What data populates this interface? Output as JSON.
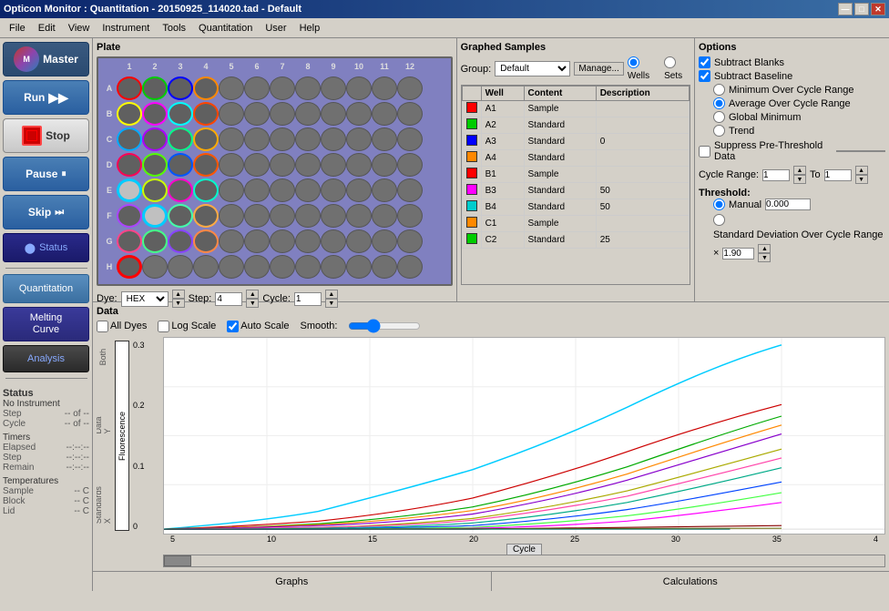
{
  "title": "Opticon Monitor : Quantitation - 20150925_114020.tad - Default",
  "titlebar": {
    "buttons": [
      "—",
      "□",
      "✕"
    ]
  },
  "menu": {
    "items": [
      "File",
      "Edit",
      "View",
      "Instrument",
      "Tools",
      "Quantitation",
      "User",
      "Help"
    ]
  },
  "sidebar": {
    "master_label": "Master",
    "run_label": "Run",
    "stop_label": "Stop",
    "pause_label": "Pause",
    "skip_label": "Skip",
    "status_label": "Status",
    "quantitation_label": "Quantitation",
    "melting_curve_label": "Melting\nCurve",
    "analysis_label": "Analysis"
  },
  "status": {
    "title": "Status",
    "instrument": "No Instrument",
    "step_label": "Step",
    "step_value": "-- of --",
    "cycle_label": "Cycle",
    "cycle_value": "-- of --",
    "timers_label": "Timers",
    "elapsed_label": "Elapsed",
    "elapsed_value": "--:--:--",
    "step_timer_label": "Step",
    "step_timer_value": "--:--:--",
    "remain_label": "Remain",
    "remain_value": "--:--:--",
    "temps_label": "Temperatures",
    "sample_label": "Sample",
    "sample_value": "-- C",
    "block_label": "Block",
    "block_value": "-- C",
    "lid_label": "Lid",
    "lid_value": "-- C"
  },
  "plate": {
    "title": "Plate",
    "col_labels": [
      "1",
      "2",
      "3",
      "4",
      "5",
      "6",
      "7",
      "8",
      "9",
      "10",
      "11",
      "12"
    ],
    "row_labels": [
      "A",
      "B",
      "C",
      "D",
      "E",
      "F",
      "G",
      "H"
    ],
    "dye_label": "Dye:",
    "dye_value": "HEX",
    "step_label": "Step:",
    "step_value": "4",
    "cycle_label": "Cycle:",
    "cycle_value": "1"
  },
  "graphed_samples": {
    "title": "Graphed Samples",
    "group_label": "Group:",
    "group_value": "Default",
    "manage_label": "Manage...",
    "wells_label": "Wells",
    "sets_label": "Sets",
    "columns": [
      "Well",
      "Content",
      "Description"
    ],
    "rows": [
      {
        "color": "#ff0000",
        "well": "A1",
        "content": "Sample",
        "description": ""
      },
      {
        "color": "#00cc00",
        "well": "A2",
        "content": "Standard",
        "description": ""
      },
      {
        "color": "#0000ff",
        "well": "A3",
        "content": "Standard",
        "description": "0"
      },
      {
        "color": "#ff8800",
        "well": "A4",
        "content": "Standard",
        "description": ""
      },
      {
        "color": "#ff0000",
        "well": "B1",
        "content": "Sample",
        "description": ""
      },
      {
        "color": "#ff00ff",
        "well": "B3",
        "content": "Standard",
        "description": "50"
      },
      {
        "color": "#00cccc",
        "well": "B4",
        "content": "Standard",
        "description": "50"
      },
      {
        "color": "#ff8800",
        "well": "C1",
        "content": "Sample",
        "description": ""
      },
      {
        "color": "#00cc00",
        "well": "C2",
        "content": "Standard",
        "description": "25"
      }
    ]
  },
  "options": {
    "title": "Options",
    "subtract_blanks": "Subtract Blanks",
    "subtract_blanks_checked": true,
    "subtract_baseline": "Subtract Baseline",
    "subtract_baseline_checked": true,
    "baseline_options": [
      "Minimum Over Cycle Range",
      "Average Over Cycle Range",
      "Global Minimum",
      "Trend"
    ],
    "baseline_selected": 1,
    "suppress_label": "Suppress Pre-Threshold Data",
    "cycle_range_label": "Cycle Range:",
    "cycle_from": "1",
    "to_label": "To",
    "cycle_to": "1",
    "threshold_label": "Threshold:",
    "manual_label": "Manual",
    "manual_value": "0.000",
    "std_dev_label": "Standard Deviation Over Cycle Range",
    "std_dev_value": "1.90"
  },
  "data": {
    "title": "Data",
    "all_dyes_label": "All Dyes",
    "log_scale_label": "Log Scale",
    "auto_scale_label": "Auto Scale",
    "auto_scale_checked": true,
    "smooth_label": "Smooth:",
    "y_axis_values": [
      "0.3",
      "0.2",
      "0.1",
      "0"
    ],
    "x_axis_values": [
      "5",
      "10",
      "15",
      "20",
      "25",
      "30",
      "35",
      "4"
    ],
    "x_axis_label": "Cycle",
    "y_axis_label": "Fluorescence",
    "left_labels": [
      "Both",
      "Data",
      "Y",
      "Standards",
      "X"
    ],
    "bottom_sections": [
      "Graphs",
      "Calculations"
    ]
  }
}
